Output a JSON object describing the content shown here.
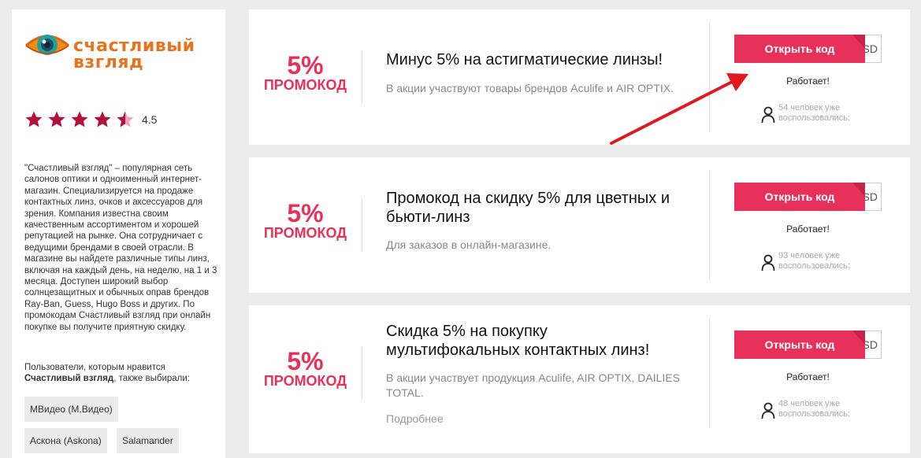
{
  "brand": {
    "name_line1": "счастливый",
    "name_line2": "взгляд",
    "brand_color": "#e8731f"
  },
  "rating": {
    "value": "4.5",
    "stars_filled": 4.5,
    "stars_total": 5,
    "star_color": "#b0113e"
  },
  "description": "\"Счастливый взгляд\" – популярная сеть салонов оптики и одноименный интернет-магазин. Специализируется на продаже контактных линз, очков и аксессуаров для зрения. Компания известна своим качественным ассортиментом и хорошей репутацией на рынке. Она сотрудничает с ведущими брендами в своей отрасли. В магазине вы найдете различные типы линз, включая на каждый день, на неделю, на 1 и 3 месяца. Доступен широкий выбор солнцезащитных и обычных оправ брендов Ray-Ban, Guess, Hugo Boss и других. По промокодам Счастливый взгляд при онлайн покупке вы получите приятную скидку.",
  "also_liked": {
    "prefix": "Пользователи, которым нравится ",
    "store": "Счастливый взгляд",
    "suffix": ", также выбирали:",
    "tags": [
      "МВидео (М.Видео)",
      "Аскона (Askona)",
      "Salamander"
    ]
  },
  "offers": [
    {
      "percent": "5%",
      "badge_label": "ПРОМОКОД",
      "title": "Минус 5% на астигматические линзы!",
      "subtitle": "В акции участвуют товары брендов Aculife и AIR OPTIX.",
      "button": "Открыть код",
      "code_peek": "SD",
      "status": "Работает!",
      "used": "54 человек уже воспользовались:",
      "more": ""
    },
    {
      "percent": "5%",
      "badge_label": "ПРОМОКОД",
      "title": "Промокод на скидку 5% для цветных и бьюти-линз",
      "subtitle": "Для заказов в онлайн-магазине.",
      "button": "Открыть код",
      "code_peek": "SD",
      "status": "Работает!",
      "used": "93 человек уже воспользовались:",
      "more": ""
    },
    {
      "percent": "5%",
      "badge_label": "ПРОМОКОД",
      "title": "Скидка 5% на покупку мультифокальных контактных линз!",
      "subtitle": "В акции участвует продукция Aculife, AIR OPTIX, DAILIES TOTAL.",
      "button": "Открыть код",
      "code_peek": "SD",
      "status": "Работает!",
      "used": "48 человек уже воспользовались:",
      "more": "Подробнее"
    }
  ],
  "colors": {
    "accent": "#e8315a",
    "annotation_arrow": "#e0191f"
  }
}
